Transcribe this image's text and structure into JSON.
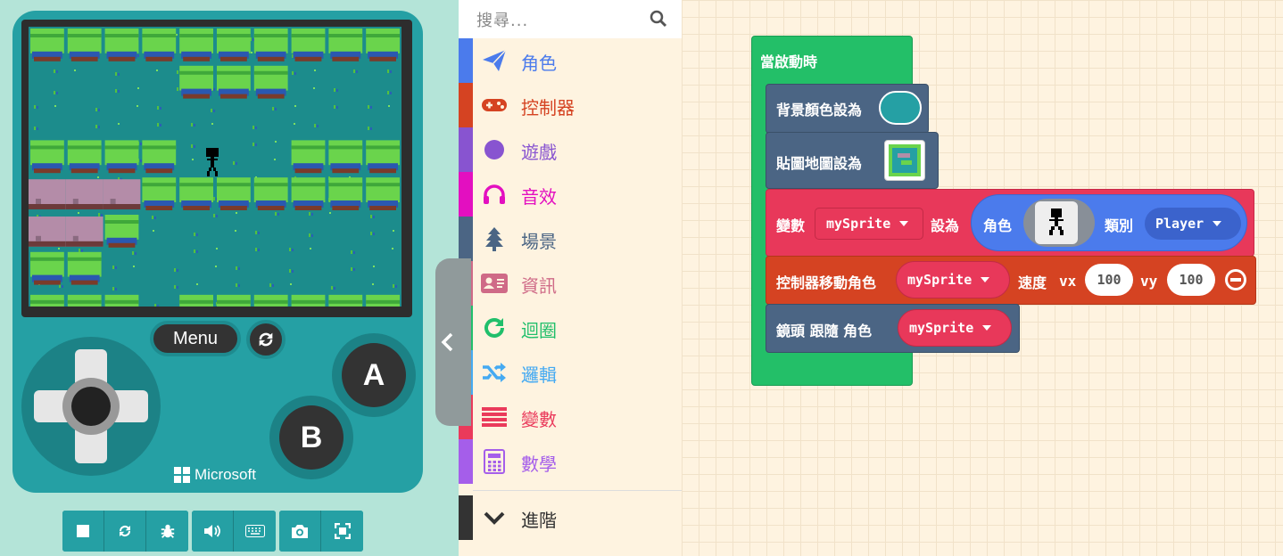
{
  "simulator": {
    "menu_label": "Menu",
    "btn_a": "A",
    "btn_b": "B",
    "brand": "Microsoft",
    "toolbar_icons": [
      "stop-icon",
      "restart-icon",
      "debug-icon",
      "sound-icon",
      "keyboard-icon",
      "screenshot-icon",
      "fullscreen-icon"
    ]
  },
  "toolbox": {
    "search_placeholder": "搜尋...",
    "categories": [
      {
        "label": "角色",
        "color": "#4b7bec",
        "icon": "paper-plane-icon"
      },
      {
        "label": "控制器",
        "color": "#d54322",
        "icon": "gamepad-icon"
      },
      {
        "label": "遊戲",
        "color": "#8854d0",
        "icon": "circle-icon"
      },
      {
        "label": "音效",
        "color": "#e30fc0",
        "icon": "headphones-icon"
      },
      {
        "label": "場景",
        "color": "#4b6584",
        "icon": "tree-icon"
      },
      {
        "label": "資訊",
        "color": "#cf6a87",
        "icon": "id-card-icon"
      },
      {
        "label": "迴圈",
        "color": "#20bf6b",
        "icon": "refresh-icon"
      },
      {
        "label": "邏輯",
        "color": "#45aaf2",
        "icon": "shuffle-icon"
      },
      {
        "label": "變數",
        "color": "#ea3a5b",
        "icon": "list-icon"
      },
      {
        "label": "數學",
        "color": "#a55eea",
        "icon": "calculator-icon"
      }
    ],
    "advanced": {
      "label": "進階",
      "color": "#333333",
      "icon": "chevron-down-icon"
    }
  },
  "workspace": {
    "on_start": "當啟動時",
    "set_background": "背景顏色設為",
    "background_color": "#25a0a4",
    "set_tilemap": "貼圖地圖設為",
    "set_var": "變數",
    "var_name": "mySprite",
    "set_to": "設為",
    "sprite_label": "角色",
    "kind_label": "類別",
    "kind_value": "Player",
    "move_with_controller": "控制器移動角色",
    "move_var": "mySprite",
    "speed_label": "速度",
    "vx_label": "vx",
    "vx_value": "100",
    "vy_label": "vy",
    "vy_value": "100",
    "camera_follow": "鏡頭 跟隨 角色",
    "camera_var": "mySprite"
  },
  "colors": {
    "loops_green": "#23bf68",
    "scene_slate": "#4b6584",
    "variables_red": "#e8385a",
    "controller_red": "#d54322",
    "sprites_blue": "#4b7bec"
  }
}
